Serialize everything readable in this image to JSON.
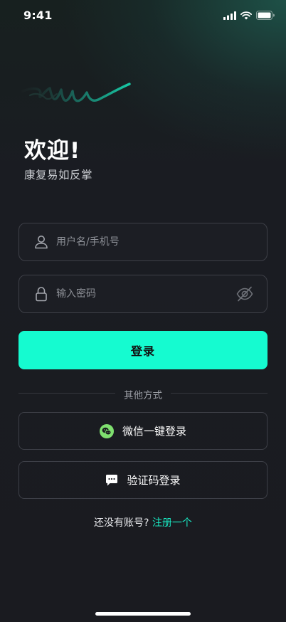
{
  "status_bar": {
    "time": "9:41"
  },
  "header": {
    "title": "欢迎!",
    "subtitle": "康复易如反掌"
  },
  "form": {
    "username_placeholder": "用户名/手机号",
    "password_placeholder": "输入密码",
    "login_label": "登录"
  },
  "divider": {
    "label": "其他方式"
  },
  "alt_login": {
    "wechat_label": "微信一键登录",
    "sms_label": "验证码登录"
  },
  "footer": {
    "prompt": "还没有账号?",
    "register_link": "注册一个"
  },
  "colors": {
    "accent": "#15fbd0",
    "link": "#19e8c2",
    "background": "#1a1b20",
    "border": "#3e4048",
    "wechat": "#7fe06f"
  }
}
